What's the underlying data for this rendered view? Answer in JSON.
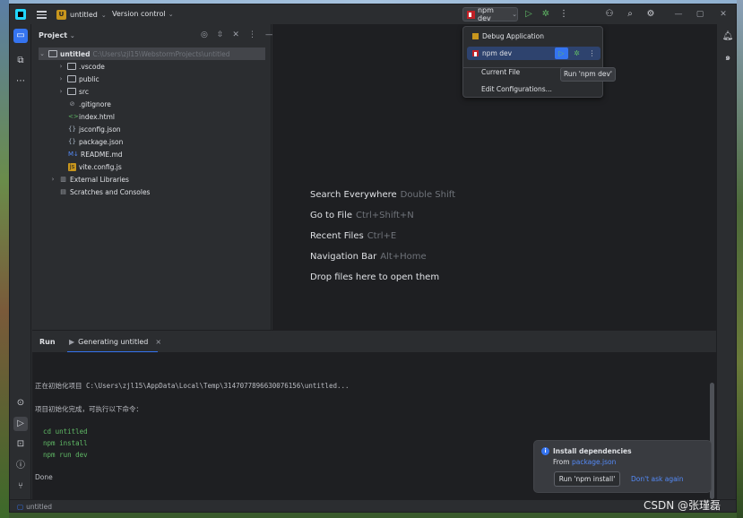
{
  "titlebar": {
    "project_badge": "U",
    "project_name": "untitled",
    "version_control": "Version control",
    "run_config": "npm dev"
  },
  "project_panel": {
    "title": "Project",
    "root_name": "untitled",
    "root_path": "C:\\Users\\zjl15\\WebstormProjects\\untitled",
    "items": [
      {
        "label": ".vscode"
      },
      {
        "label": "public"
      },
      {
        "label": "src"
      },
      {
        "label": ".gitignore"
      },
      {
        "label": "index.html"
      },
      {
        "label": "jsconfig.json"
      },
      {
        "label": "package.json"
      },
      {
        "label": "README.md",
        "badge": "M↓"
      },
      {
        "label": "vite.config.js"
      },
      {
        "label": "External Libraries"
      },
      {
        "label": "Scratches and Consoles"
      }
    ]
  },
  "editor_hints": [
    {
      "label": "Search Everywhere",
      "key": "Double Shift"
    },
    {
      "label": "Go to File",
      "key": "Ctrl+Shift+N"
    },
    {
      "label": "Recent Files",
      "key": "Ctrl+E"
    },
    {
      "label": "Navigation Bar",
      "key": "Alt+Home"
    },
    {
      "label": "Drop files here to open them",
      "key": ""
    }
  ],
  "run_panel": {
    "tab_run": "Run",
    "tab_generating": "Generating untitled",
    "lines": [
      "正在初始化项目 C:\\Users\\zjl15\\AppData\\Local\\Temp\\3147077896630076156\\untitled...",
      "项目初始化完成，可执行以下命令：",
      "  cd untitled",
      "  npm install",
      "  npm run dev",
      "Done"
    ]
  },
  "run_popup": {
    "debug_app": "Debug Application",
    "npm_dev": "npm dev",
    "current_file": "Current File",
    "edit_configs": "Edit Configurations...",
    "tooltip": "Run 'npm dev'"
  },
  "notification": {
    "title": "Install dependencies",
    "from_prefix": "From",
    "from_link": "package.json",
    "button": "Run 'npm install'",
    "dont_ask": "Don't ask again"
  },
  "status_bar": {
    "project": "untitled"
  },
  "watermark": "CSDN @张瑾磊",
  "colors": {
    "accent": "#3574f0",
    "run_green": "#5fb865",
    "npm_red": "#c12127",
    "editor_bg": "#1e1f22",
    "panel_bg": "#2b2d30"
  }
}
